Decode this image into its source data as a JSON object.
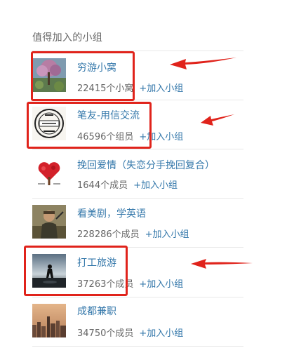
{
  "section_title": "值得加入的小组",
  "groups": [
    {
      "name": "穷游小窝",
      "count": "22415个小窝",
      "join": "+加入小组",
      "thumb_icon": "painting-thumbnail"
    },
    {
      "name": "笔友-用信交流",
      "count": "46596个组员",
      "join": "+加入小组",
      "thumb_icon": "postmark-stamp-thumbnail"
    },
    {
      "name": "挽回爱情（失恋分手挽回复合）",
      "count": "1644个成员",
      "join": "+加入小组",
      "thumb_icon": "heart-tree-thumbnail"
    },
    {
      "name": "看美剧，学英语",
      "count": "228286个成员",
      "join": "+加入小组",
      "thumb_icon": "tv-character-thumbnail"
    },
    {
      "name": "打工旅游",
      "count": "37263个成员",
      "join": "+加入小组",
      "thumb_icon": "traveler-silhouette-thumbnail"
    },
    {
      "name": "成都兼职",
      "count": "34750个成员",
      "join": "+加入小组",
      "thumb_icon": "city-skyline-thumbnail"
    }
  ],
  "colors": {
    "link": "#3377aa",
    "text_muted": "#666666",
    "annotation_red": "#e0231b",
    "divider": "#e8e8e8"
  }
}
